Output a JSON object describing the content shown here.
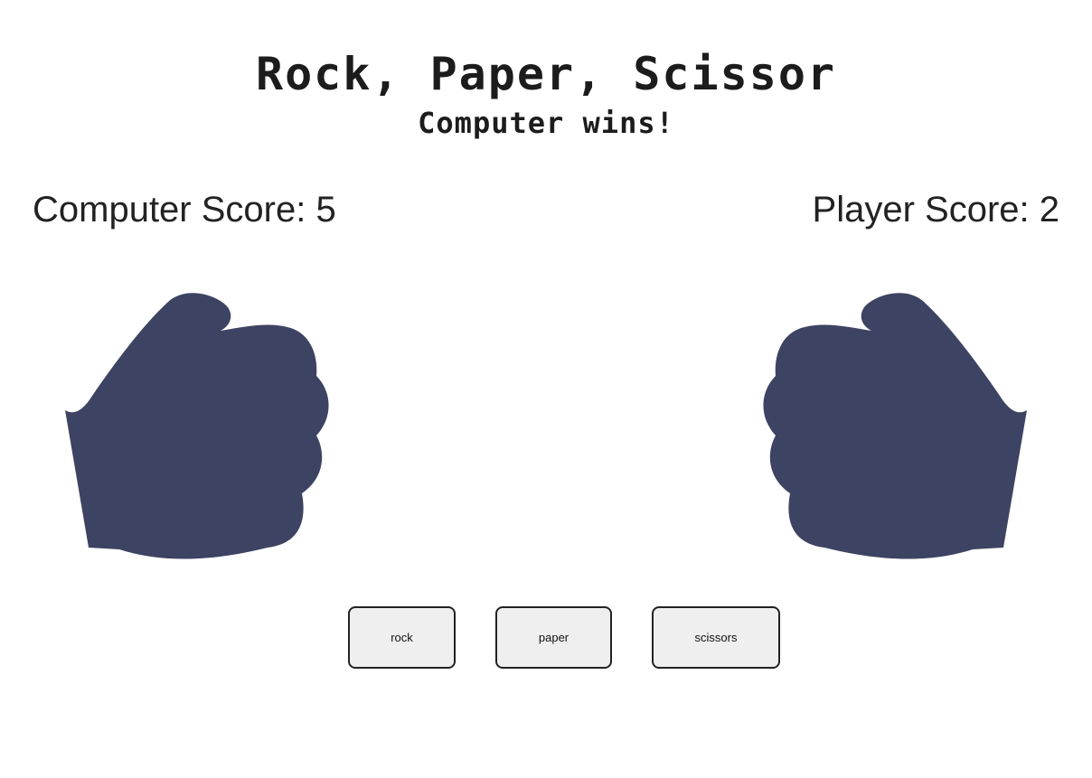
{
  "game": {
    "title": "Rock, Paper, Scissor",
    "result": "Computer wins!"
  },
  "scores": {
    "computer_label": "Computer Score: 5",
    "player_label": "Player Score: 2",
    "computer": 5,
    "player": 2
  },
  "hands": {
    "computer_icon": "rock-fist-icon",
    "player_icon": "rock-fist-icon",
    "color": "#3d4362"
  },
  "buttons": {
    "rock": "rock",
    "paper": "paper",
    "scissors": "scissors"
  }
}
